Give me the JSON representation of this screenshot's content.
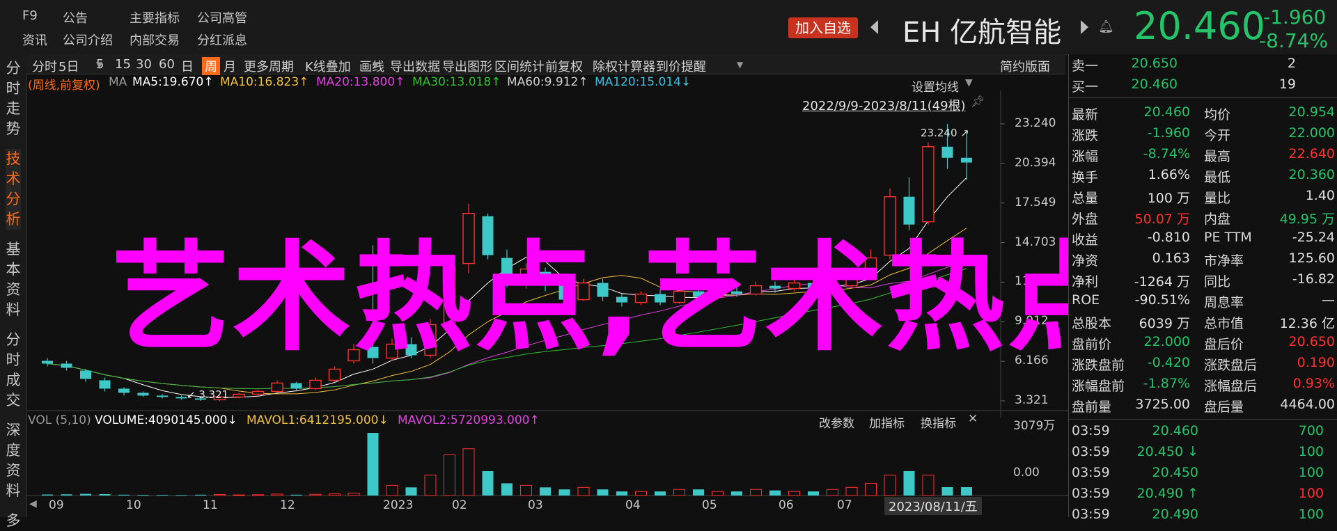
{
  "header": {
    "nav_row1": [
      "F9",
      "公告",
      "主要指标",
      "公司高管"
    ],
    "nav_row2": [
      "资讯",
      "公司介绍",
      "内部交易",
      "分红派息"
    ],
    "add_watchlist": "加入自选",
    "stock_code": "EH",
    "stock_name": "亿航智能",
    "price": "20.460",
    "change": "-1.960",
    "change_pct": "-8.74%"
  },
  "sidebar": {
    "items": [
      "分时走势",
      "技术分析",
      "基本资料",
      "分时成交",
      "深度资料",
      "多"
    ],
    "active_index": 1
  },
  "toolbar": {
    "items": [
      "分时",
      "5日",
      "5",
      "15",
      "30",
      "60",
      "日",
      "周",
      "月",
      "更多周期",
      "K线叠加",
      "画线",
      "导出数据",
      "导出图形",
      "区间统计",
      "前复权",
      "除权计算器",
      "到价提醒"
    ],
    "selected": "周",
    "right_label": "简约版面"
  },
  "ma_line": {
    "period": "(周线,前复权)",
    "ma_label": "MA",
    "ma5": "MA5:19.670↑",
    "ma10": "MA10:16.823↑",
    "ma20": "MA20:13.800↑",
    "ma30": "MA30:13.018↑",
    "ma60": "MA60:9.912↑",
    "ma120": "MA120:15.014↓"
  },
  "chart_controls": {
    "settings": "设置均线",
    "range": "2022/9/9-2023/8/11(49根)",
    "high_mark": "23.240",
    "low_mark": "3.321",
    "vol_label": "VOL (5,10)",
    "volume": "VOLUME:4090145.000↓",
    "mavol1": "MAVOL1:6412195.000↓",
    "mavol2": "MAVOL2:5720993.000↑",
    "vol_buttons": [
      "改参数",
      "加指标",
      "换指标"
    ],
    "cursor_date": "2023/08/11/五"
  },
  "overlay_text": "艺术热点,艺术热点",
  "colors": {
    "up": "#ff3030",
    "down": "#25c46a",
    "accent": "#ff6a1a",
    "candle_down": "#3ec8c8",
    "overlay": "#ff00ff"
  },
  "chart_data": {
    "type": "candlestick",
    "x_ticks": [
      "09",
      "10",
      "11",
      "12",
      "2023",
      "02",
      "03",
      "04",
      "05",
      "06",
      "07",
      "08"
    ],
    "y_ticks": [
      "23.240",
      "20.394",
      "17.549",
      "14.703",
      "11.858",
      "9.012",
      "6.166",
      "3.321"
    ],
    "ylim": [
      3.321,
      23.24
    ],
    "vol_ticks": [
      "3079万",
      "0.00"
    ],
    "candles": [
      {
        "o": 6.2,
        "c": 6.0,
        "h": 6.4,
        "l": 5.8
      },
      {
        "o": 6.0,
        "c": 5.7,
        "h": 6.2,
        "l": 5.5
      },
      {
        "o": 5.5,
        "c": 4.9,
        "h": 5.6,
        "l": 4.7
      },
      {
        "o": 4.8,
        "c": 4.2,
        "h": 5.0,
        "l": 4.0
      },
      {
        "o": 4.2,
        "c": 3.9,
        "h": 4.3,
        "l": 3.7
      },
      {
        "o": 3.9,
        "c": 3.7,
        "h": 4.0,
        "l": 3.6
      },
      {
        "o": 3.7,
        "c": 3.6,
        "h": 3.8,
        "l": 3.5
      },
      {
        "o": 3.6,
        "c": 3.5,
        "h": 3.7,
        "l": 3.4
      },
      {
        "o": 3.5,
        "c": 3.4,
        "h": 3.6,
        "l": 3.32
      },
      {
        "o": 3.4,
        "c": 3.6,
        "h": 3.7,
        "l": 3.3
      },
      {
        "o": 3.6,
        "c": 3.8,
        "h": 3.9,
        "l": 3.5
      },
      {
        "o": 3.8,
        "c": 4.0,
        "h": 4.1,
        "l": 3.7
      },
      {
        "o": 4.0,
        "c": 4.6,
        "h": 4.8,
        "l": 3.9
      },
      {
        "o": 4.6,
        "c": 4.2,
        "h": 4.7,
        "l": 4.0
      },
      {
        "o": 4.2,
        "c": 4.8,
        "h": 5.0,
        "l": 4.1
      },
      {
        "o": 4.8,
        "c": 5.6,
        "h": 5.8,
        "l": 4.7
      },
      {
        "o": 6.2,
        "c": 7.0,
        "h": 7.4,
        "l": 6.0
      },
      {
        "o": 7.2,
        "c": 6.4,
        "h": 14.5,
        "l": 6.0
      },
      {
        "o": 6.4,
        "c": 7.4,
        "h": 7.8,
        "l": 6.2
      },
      {
        "o": 7.4,
        "c": 6.6,
        "h": 7.9,
        "l": 6.4
      },
      {
        "o": 6.6,
        "c": 8.8,
        "h": 9.2,
        "l": 6.4
      },
      {
        "o": 8.8,
        "c": 13.0,
        "h": 13.8,
        "l": 8.5
      },
      {
        "o": 13.2,
        "c": 16.8,
        "h": 17.5,
        "l": 12.5
      },
      {
        "o": 16.6,
        "c": 13.8,
        "h": 16.8,
        "l": 13.5
      },
      {
        "o": 13.6,
        "c": 11.8,
        "h": 14.2,
        "l": 11.5
      },
      {
        "o": 11.8,
        "c": 12.8,
        "h": 13.2,
        "l": 11.4
      },
      {
        "o": 12.6,
        "c": 11.6,
        "h": 12.9,
        "l": 11.2
      },
      {
        "o": 11.6,
        "c": 10.6,
        "h": 11.9,
        "l": 10.3
      },
      {
        "o": 10.6,
        "c": 11.8,
        "h": 12.1,
        "l": 10.5
      },
      {
        "o": 11.8,
        "c": 10.8,
        "h": 12.1,
        "l": 10.5
      },
      {
        "o": 10.8,
        "c": 10.4,
        "h": 11.0,
        "l": 10.1
      },
      {
        "o": 10.4,
        "c": 11.0,
        "h": 11.2,
        "l": 10.2
      },
      {
        "o": 11.0,
        "c": 10.4,
        "h": 11.3,
        "l": 10.2
      },
      {
        "o": 10.4,
        "c": 11.2,
        "h": 11.6,
        "l": 10.3
      },
      {
        "o": 11.2,
        "c": 10.8,
        "h": 11.5,
        "l": 10.5
      },
      {
        "o": 10.8,
        "c": 11.2,
        "h": 11.5,
        "l": 10.6
      },
      {
        "o": 11.2,
        "c": 11.0,
        "h": 11.5,
        "l": 10.8
      },
      {
        "o": 11.0,
        "c": 11.6,
        "h": 11.9,
        "l": 10.9
      },
      {
        "o": 11.6,
        "c": 11.4,
        "h": 11.9,
        "l": 11.1
      },
      {
        "o": 11.4,
        "c": 11.8,
        "h": 12.1,
        "l": 11.2
      },
      {
        "o": 11.8,
        "c": 11.4,
        "h": 12.0,
        "l": 11.2
      },
      {
        "o": 11.4,
        "c": 11.6,
        "h": 11.9,
        "l": 11.2
      },
      {
        "o": 11.6,
        "c": 12.2,
        "h": 12.8,
        "l": 11.4
      },
      {
        "o": 12.2,
        "c": 13.6,
        "h": 14.2,
        "l": 12.0
      },
      {
        "o": 13.8,
        "c": 18.0,
        "h": 18.6,
        "l": 13.5
      },
      {
        "o": 18.0,
        "c": 16.0,
        "h": 19.4,
        "l": 15.6
      },
      {
        "o": 16.2,
        "c": 21.6,
        "h": 21.9,
        "l": 16.0
      },
      {
        "o": 21.6,
        "c": 20.8,
        "h": 23.24,
        "l": 20.0
      },
      {
        "o": 20.8,
        "c": 20.46,
        "h": 22.6,
        "l": 19.2
      }
    ],
    "volumes": [
      0.5,
      0.6,
      0.8,
      0.7,
      0.4,
      0.3,
      0.3,
      0.2,
      0.4,
      0.5,
      0.3,
      0.4,
      0.7,
      0.4,
      0.6,
      0.8,
      1.2,
      30.79,
      5.0,
      4.0,
      10.0,
      20.0,
      23.0,
      12.0,
      6.0,
      5.0,
      4.0,
      3.0,
      4.0,
      3.0,
      2.0,
      2.0,
      2.0,
      3.0,
      3.0,
      2.0,
      2.0,
      3.0,
      2.5,
      2.0,
      2.0,
      3.0,
      4.0,
      6.0,
      10.0,
      12.0,
      10.0,
      4.1,
      4.09
    ]
  },
  "quote_panel": {
    "ask": {
      "label": "卖一",
      "price": "20.650",
      "qty": "2"
    },
    "bid": {
      "label": "买一",
      "price": "20.460",
      "qty": "19"
    },
    "rows": [
      {
        "l1": "最新",
        "v1": "20.460",
        "c1": "g",
        "l2": "均价",
        "v2": "20.954",
        "c2": "g"
      },
      {
        "l1": "涨跌",
        "v1": "-1.960",
        "c1": "g",
        "l2": "今开",
        "v2": "22.000",
        "c2": "g"
      },
      {
        "l1": "涨幅",
        "v1": "-8.74%",
        "c1": "g",
        "l2": "最高",
        "v2": "22.640",
        "c2": "r"
      },
      {
        "l1": "换手",
        "v1": "1.66%",
        "c1": "w",
        "l2": "最低",
        "v2": "20.360",
        "c2": "g"
      },
      {
        "l1": "总量",
        "v1": "100 万",
        "c1": "w",
        "l2": "量比",
        "v2": "1.40",
        "c2": "w"
      },
      {
        "l1": "外盘",
        "v1": "50.07 万",
        "c1": "r",
        "l2": "内盘",
        "v2": "49.95 万",
        "c2": "g"
      },
      {
        "l1": "收益",
        "v1": "-0.810",
        "c1": "w",
        "l2": "PE TTM",
        "v2": "-25.24",
        "c2": "w"
      },
      {
        "l1": "净资",
        "v1": "0.163",
        "c1": "w",
        "l2": "市净率",
        "v2": "125.60",
        "c2": "w"
      },
      {
        "l1": "净利",
        "v1": "-1264 万",
        "c1": "w",
        "l2": "同比",
        "v2": "-16.82",
        "c2": "w"
      },
      {
        "l1": "ROE",
        "v1": "-90.51%",
        "c1": "w",
        "l2": "周息率",
        "v2": "—",
        "c2": "w"
      },
      {
        "l1": "总股本",
        "v1": "6039 万",
        "c1": "w",
        "l2": "总市值",
        "v2": "12.36 亿",
        "c2": "w"
      },
      {
        "l1": "盘前价",
        "v1": "22.000",
        "c1": "g",
        "l2": "盘后价",
        "v2": "20.650",
        "c2": "r"
      },
      {
        "l1": "涨跌盘前",
        "v1": "-0.420",
        "c1": "g",
        "l2": "涨跌盘后",
        "v2": "0.190",
        "c2": "r"
      },
      {
        "l1": "涨幅盘前",
        "v1": "-1.87%",
        "c1": "g",
        "l2": "涨幅盘后",
        "v2": "0.93%",
        "c2": "r"
      },
      {
        "l1": "盘前量",
        "v1": "3725.00",
        "c1": "w",
        "l2": "盘后量",
        "v2": "4464.00",
        "c2": "w"
      }
    ],
    "ticks": [
      {
        "time": "03:59",
        "price": "20.460",
        "arrow": "",
        "qty": "700",
        "pc": "g",
        "qc": "g"
      },
      {
        "time": "03:59",
        "price": "20.450 ↓",
        "arrow": "",
        "qty": "100",
        "pc": "g",
        "qc": "g"
      },
      {
        "time": "03:59",
        "price": "20.450",
        "arrow": "",
        "qty": "100",
        "pc": "g",
        "qc": "g"
      },
      {
        "time": "03:59",
        "price": "20.490 ↑",
        "arrow": "",
        "qty": "100",
        "pc": "g",
        "qc": "r"
      },
      {
        "time": "03:59",
        "price": "20.490",
        "arrow": "",
        "qty": "100",
        "pc": "g",
        "qc": "g"
      }
    ]
  }
}
